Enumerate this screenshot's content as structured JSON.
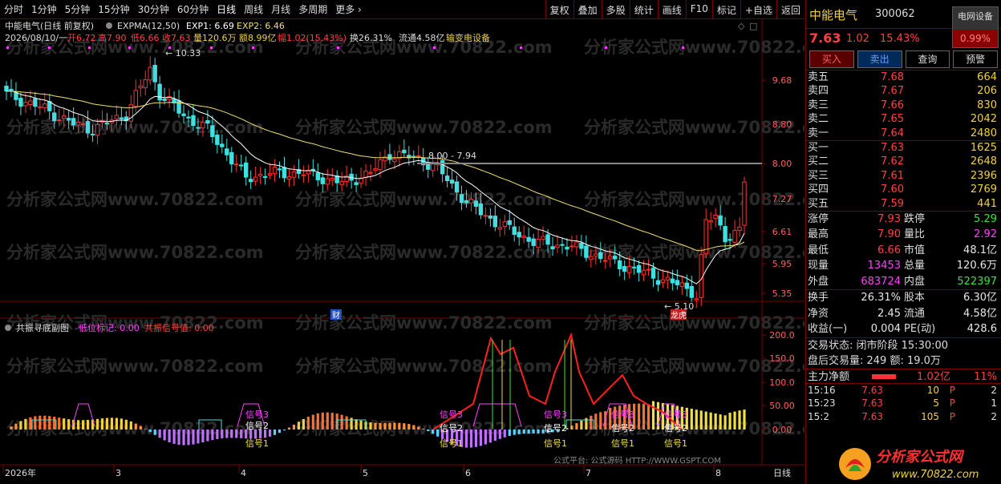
{
  "toolbar": {
    "periods": [
      "分时",
      "1分钟",
      "5分钟",
      "15分钟",
      "30分钟",
      "60分钟",
      "日线",
      "周线",
      "月线",
      "多周期",
      "更多"
    ],
    "active_period": "日线",
    "right_buttons": [
      "复权",
      "叠加",
      "多股",
      "统计",
      "画线",
      "F10",
      "标记",
      "+自选",
      "返回"
    ]
  },
  "chart": {
    "title": "中能电气(日线 前复权)",
    "expma_label": "EXPMA(12,50)",
    "exp1": "EXP1: 6.69",
    "exp2": "EXP2: 6.46",
    "info_date": "2026/08/10/一",
    "info_open": "开6.72",
    "info_high": "高7.90",
    "info_low": "低6.66",
    "info_close": "收7.63",
    "info_vol": "量120.6万",
    "info_amt": "额8.99亿",
    "info_range": "幅1.02(15.43%)",
    "info_turn": "换26.31%",
    "info_float": "流通4.58亿",
    "info_sector": "输变电设备",
    "watermark": "分析家公式网www.70822.com",
    "annot_high": "10.33",
    "annot_low": "5.10",
    "annot_line": "8.00 - 7.94",
    "annot_cai": "财",
    "annot_long": "龙虎",
    "price_axis": [
      "9.68",
      "8.80",
      "8.00",
      "7.27",
      "6.61",
      "5.95",
      "5.35"
    ],
    "sub_title": "共振寻底副图",
    "sub_low_label": "低位标记: 0.00",
    "sub_signal_label": "共振信号值: 0.00",
    "sub_axis": [
      "200.0",
      "150.0",
      "100.0",
      "50.00",
      "0.00"
    ],
    "signal1": "信号1",
    "signal2": "信号2",
    "signal3": "信号3",
    "date_axis": [
      "2026年",
      "3",
      "4",
      "5",
      "6",
      "7",
      "8"
    ],
    "date_period": "日线",
    "footer_note": "公式平台: 公式源码 HTTP://WWW.GSPT.COM"
  },
  "panel": {
    "name": "中能电气",
    "code": "300062",
    "industry": "电网设备",
    "industry_pct": "0.99%",
    "price": "7.63",
    "change": "1.02",
    "change_pct": "15.43%",
    "buttons": [
      "买入",
      "卖出",
      "查询",
      "预警"
    ],
    "asks": [
      {
        "label": "卖五",
        "price": "7.68",
        "vol": "664"
      },
      {
        "label": "卖四",
        "price": "7.67",
        "vol": "206"
      },
      {
        "label": "卖三",
        "price": "7.66",
        "vol": "830"
      },
      {
        "label": "卖二",
        "price": "7.65",
        "vol": "2042"
      },
      {
        "label": "卖一",
        "price": "7.64",
        "vol": "2480"
      }
    ],
    "bids": [
      {
        "label": "买一",
        "price": "7.63",
        "vol": "1625"
      },
      {
        "label": "买二",
        "price": "7.62",
        "vol": "2648"
      },
      {
        "label": "买三",
        "price": "7.61",
        "vol": "2396"
      },
      {
        "label": "买四",
        "price": "7.60",
        "vol": "2769"
      },
      {
        "label": "买五",
        "price": "7.59",
        "vol": "441"
      }
    ],
    "stats": [
      {
        "l1": "涨停",
        "v1": "7.93",
        "c1": "red",
        "l2": "跌停",
        "v2": "5.29",
        "c2": "green"
      },
      {
        "l1": "最高",
        "v1": "7.90",
        "c1": "red",
        "l2": "量比",
        "v2": "2.92",
        "c2": "mag"
      },
      {
        "l1": "最低",
        "v1": "6.66",
        "c1": "red",
        "l2": "市值",
        "v2": "48.1亿",
        "c2": "white"
      },
      {
        "l1": "现量",
        "v1": "13453",
        "c1": "mag",
        "l2": "总量",
        "v2": "120.6万",
        "c2": "white"
      },
      {
        "l1": "外盘",
        "v1": "683724",
        "c1": "mag",
        "l2": "内盘",
        "v2": "522397",
        "c2": "green"
      }
    ],
    "stats2": [
      {
        "l1": "换手",
        "v1": "26.31%",
        "l2": "股本",
        "v2": "6.30亿"
      },
      {
        "l1": "净资",
        "v1": "2.45",
        "l2": "流通",
        "v2": "4.58亿"
      },
      {
        "l1": "收益(一)",
        "v1": "0.004",
        "l2": "PE(动)",
        "v2": "428.6"
      }
    ],
    "trade_status": "交易状态: 闭市阶段 15:30:00",
    "after_hours": "盘后交易量: 249  额: 19.0万",
    "main_flow_label": "主力净额",
    "main_flow_value": "1.02亿",
    "main_flow_pct": "11%",
    "ticks": [
      {
        "t": "15:16",
        "p": "7.63",
        "v": "10",
        "d": "P",
        "n": "2"
      },
      {
        "t": "15:23",
        "p": "7.63",
        "v": "5",
        "d": "P",
        "n": "1"
      },
      {
        "t": "15:2",
        "p": "7.63",
        "v": "105",
        "d": "P",
        "n": "2"
      }
    ],
    "logo_text": "分析家公式网",
    "logo_url": "www.70822.com"
  },
  "chart_data": {
    "type": "candlestick",
    "title": "中能电气(日线 前复权)",
    "x": [
      "2026-02",
      "2026-03",
      "2026-04",
      "2026-05",
      "2026-06",
      "2026-07",
      "2026-08"
    ],
    "price_ticks": [
      9.68,
      8.8,
      8.0,
      7.27,
      6.61,
      5.95,
      5.35
    ],
    "last_close": 7.63,
    "period_high": 10.33,
    "period_low": 5.1,
    "series": [
      {
        "name": "EXP1",
        "last": 6.69
      },
      {
        "name": "EXP2",
        "last": 6.46
      }
    ]
  }
}
